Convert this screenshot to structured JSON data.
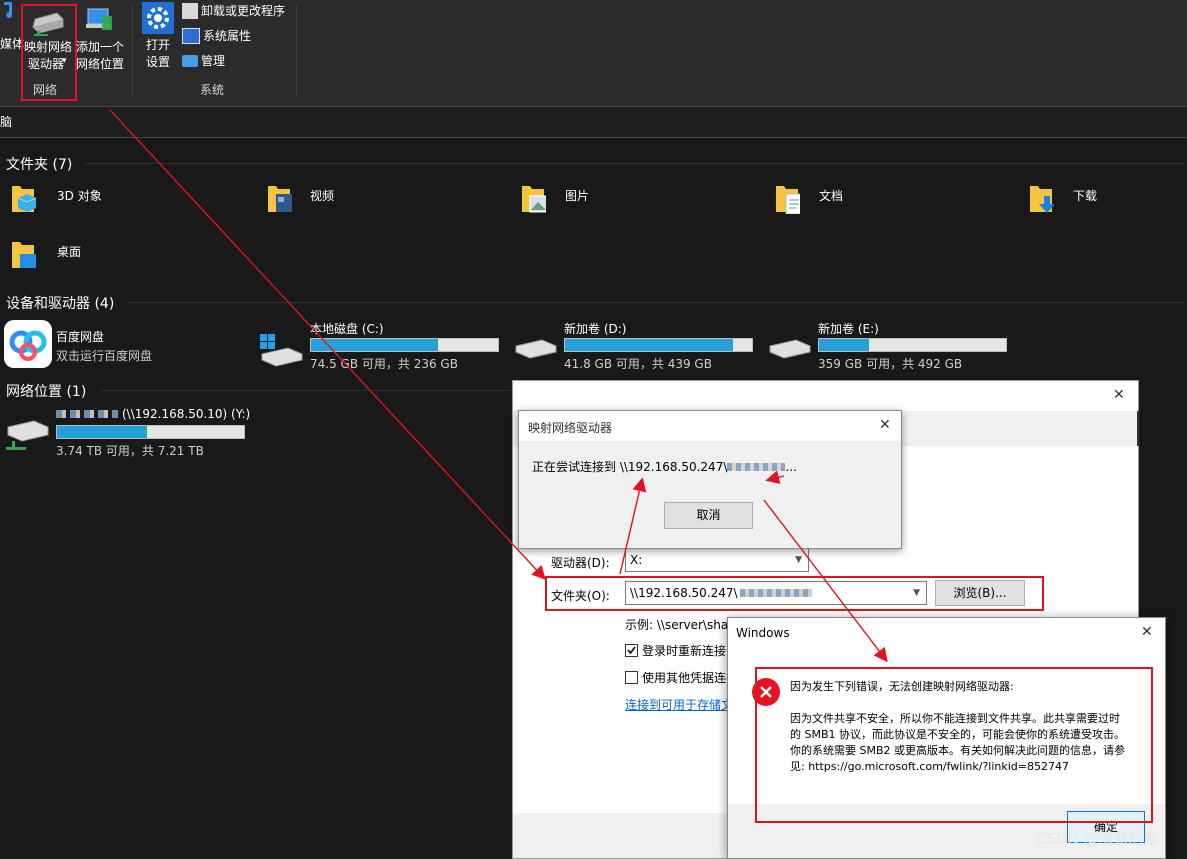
{
  "ribbon": {
    "media_partial": "媒体",
    "map_drive": [
      "映射网络",
      "驱动器"
    ],
    "map_drive_arrow": "▾",
    "add_location": [
      "添加一个",
      "网络位置"
    ],
    "group_network": "网络",
    "open_settings": [
      "打开",
      "设置"
    ],
    "uninstall": "卸载或更改程序",
    "sys_props": "系统属性",
    "manage": "管理",
    "group_system": "系统"
  },
  "address_bar": {
    "text": "脑"
  },
  "sections": {
    "folders": "文件夹 (7)",
    "devices": "设备和驱动器 (4)",
    "netloc": "网络位置 (1)"
  },
  "folders": [
    {
      "label": "3D 对象",
      "icon": "3d-objects-icon"
    },
    {
      "label": "视频",
      "icon": "videos-icon"
    },
    {
      "label": "图片",
      "icon": "pictures-icon"
    },
    {
      "label": "文档",
      "icon": "documents-icon"
    },
    {
      "label": "下载",
      "icon": "downloads-icon"
    },
    {
      "label": "桌面",
      "icon": "desktop-icon"
    }
  ],
  "drives": [
    {
      "name": "百度网盘",
      "sub": "双击运行百度网盘"
    },
    {
      "name": "本地磁盘 (C:)",
      "sub": "74.5 GB 可用，共 236 GB",
      "used_fraction": 0.68
    },
    {
      "name": "新加卷 (D:)",
      "sub": "41.8 GB 可用，共 439 GB",
      "used_fraction": 0.9
    },
    {
      "name": "新加卷 (E:)",
      "sub": "359 GB 可用，共 492 GB",
      "used_fraction": 0.27
    }
  ],
  "net_drive": {
    "name": "(\\\\192.168.50.10) (Y:)",
    "sub": "3.74 TB 可用，共 7.21 TB",
    "used_fraction": 0.48
  },
  "map_dialog": {
    "close": "✕",
    "drive_label": "驱动器(D):",
    "drive_value": "X:",
    "folder_label": "文件夹(O):",
    "folder_value": "\\\\192.168.50.247\\",
    "browse": "浏览(B)...",
    "example": "示例: \\\\server\\shar",
    "reconnect": "登录时重新连接",
    "other_cred": "使用其他凭据连接",
    "link": "连接到可用于存储文"
  },
  "progress_dialog": {
    "title": "映射网络驱动器",
    "close": "✕",
    "message": "正在尝试连接到 \\\\192.168.50.247\\",
    "message_tail": "...",
    "cancel": "取消"
  },
  "error_dialog": {
    "title": "Windows",
    "close": "✕",
    "headline": "因为发生下列错误，无法创建映射网络驱动器:",
    "body": [
      "因为文件共享不安全，所以你不能连接到文件共享。此共享需要过时",
      "的 SMB1 协议，而此协议是不安全的，可能会使你的系统遭受攻击。",
      "你的系统需要 SMB2 或更高版本。有关如何解决此问题的信息，请参",
      "见: https://go.microsoft.com/fwlink/?linkid=852747"
    ],
    "ok": "确定"
  },
  "watermark": "CSDN @随意的凰"
}
